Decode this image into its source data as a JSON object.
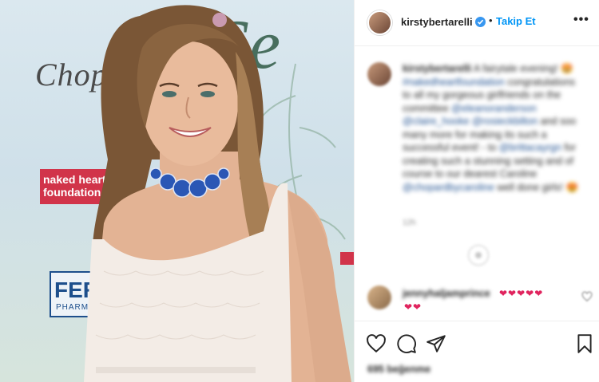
{
  "post": {
    "image_alt": "Woman in a white lace dress with a blue jeweled choker at an event backdrop",
    "backdrop": {
      "brand_left": "Chopa",
      "brand_script": "Se",
      "charity_logo": "naked heart foundation",
      "sponsor_logo_big": "FER",
      "sponsor_logo_small": "PHARMA"
    }
  },
  "header": {
    "username": "kirstybertarelli",
    "verified_icon": "verified-badge-icon",
    "separator": "•",
    "follow_label": "Takip Et",
    "more_label": "•••"
  },
  "caption": {
    "username": "kirstybertarelli",
    "text_1": "A fairytale evening! 🤩",
    "hashtag": "#nakedheartfoundation",
    "text_2": "congratulations to all my gorgeous girlfriends on the committee",
    "mention_1": "@eleanoranderson",
    "mention_2": "@claire_hooke",
    "mention_3": "@rosieckbilton",
    "text_3": "and soo many more for making its such a successful event! - to",
    "mention_4": "@brittacayrgn",
    "text_4": "for creating such a stunning setting and of course to our dearest Caroline",
    "mention_5": "@chopardbycaroline",
    "text_5": "well done girls! 😍",
    "timestamp": "12h"
  },
  "comment": {
    "username": "jennyhaljamprince",
    "hearts_line_1": "❤❤❤❤❤",
    "hearts_line_2": "❤❤"
  },
  "actions": {
    "like_icon": "heart-icon",
    "comment_icon": "comment-icon",
    "share_icon": "share-icon",
    "save_icon": "bookmark-icon",
    "likes_text": "695 beğenme"
  },
  "colors": {
    "accent": "#0095f6",
    "verified": "#3897f0",
    "heart": "#e0245e",
    "charity_red": "#d1344a"
  }
}
